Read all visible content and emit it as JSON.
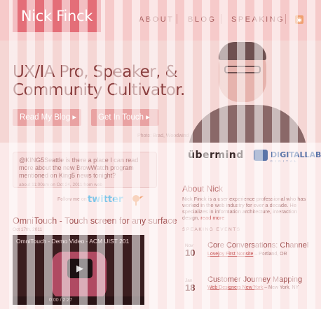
{
  "header": {
    "logo": "Nick Finck",
    "nav": [
      "ABOUT",
      "BLOG",
      "SPEAKING"
    ],
    "rss_icon": "rss-icon"
  },
  "hero": {
    "headline_line1": "UX/IA Pro, Speaker, &",
    "headline_line2": "Community Cultivator.",
    "read_blog_label": "Read My Blog ▸",
    "get_in_touch_label": "Get In Touch ▸",
    "photo_credit": "Photo: Brad, Woodwind"
  },
  "tweet": {
    "text": "@KING5Seattle is there a place I can read more about the new BrowWatch program mentioned on King5 news tonight?",
    "meta": "about 11:00am on Oct 24, 2011 from web",
    "follow_label": "Follow me on",
    "twitter_logo": "twitter"
  },
  "post": {
    "title": "OmniTouch - Touch screen for any surface",
    "date": "Oct 17th, 2011",
    "video_title": "OmniTouch - Demo Video - ACM UIST 201",
    "video_time": "0:00 / 2:27"
  },
  "sidebar": {
    "logo1": "übermind",
    "logo2": "DIGITALLAB",
    "logo2_sub": "D I G I T A L",
    "about_title": "About Nick",
    "about_text": "Nick Finck is a user experience professional who has worked in the web industry for over a decade. He specializes in information architecture, interaction design,",
    "about_link": "read more",
    "speaking_title": "SPEAKING EVENTS",
    "events": [
      {
        "month": "Nov",
        "day": "10",
        "title": "Core Conversations: Channel",
        "venue": "Lovejoy First Nonsite",
        "city": " – Portland, OR"
      },
      {
        "month": "Jan",
        "day": "18",
        "title": "Customer Journey Mapping",
        "venue": "Web Designers New York",
        "city": " – New York, NY"
      }
    ]
  },
  "colors": {
    "accent": "#e46e78",
    "background": "#fbe9e9",
    "link": "#c45050"
  }
}
